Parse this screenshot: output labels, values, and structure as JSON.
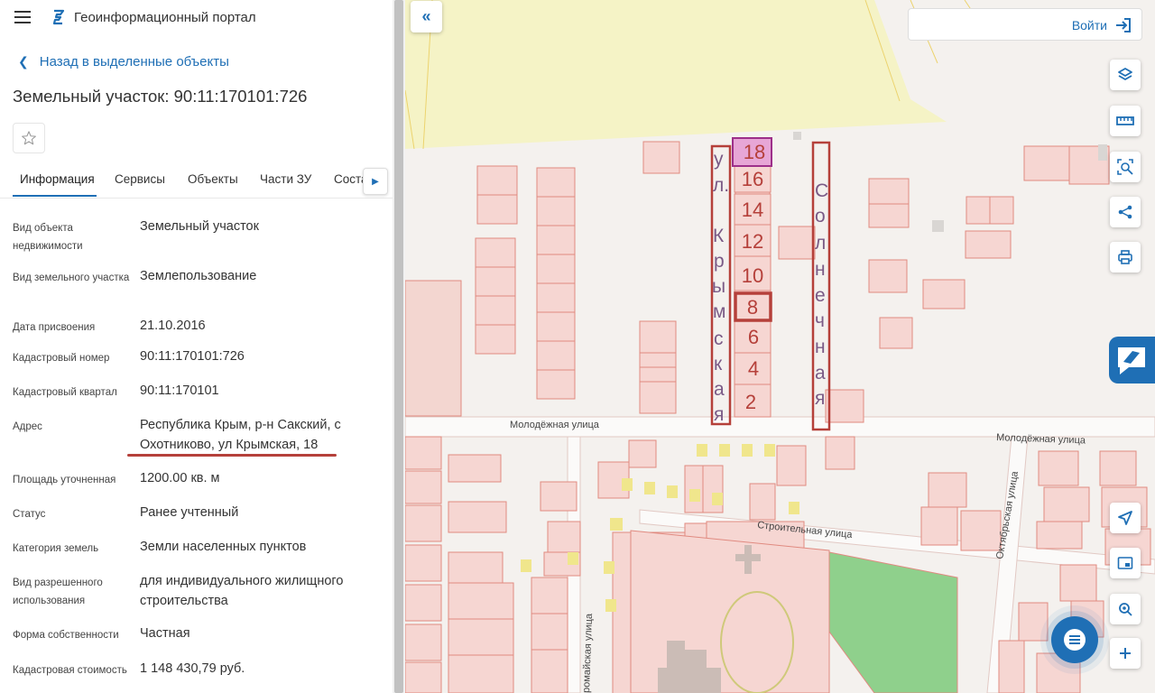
{
  "header": {
    "portal_title": "Геоинформационный портал"
  },
  "nav": {
    "back_label": "Назад в выделенные объекты"
  },
  "page": {
    "title": "Земельный участок: 90:11:170101:726"
  },
  "tabs": [
    {
      "label": "Информация",
      "active": true
    },
    {
      "label": "Сервисы",
      "active": false
    },
    {
      "label": "Объекты",
      "active": false
    },
    {
      "label": "Части ЗУ",
      "active": false
    },
    {
      "label": "Состав",
      "active": false
    }
  ],
  "properties": [
    {
      "label": "Вид объекта недвижимости",
      "value": "Земельный участок"
    },
    {
      "label": "Вид земельного участка",
      "value": "Землепользование"
    },
    {
      "label": "Дата присвоения",
      "value": "21.10.2016"
    },
    {
      "label": "Кадастровый номер",
      "value": "90:11:170101:726"
    },
    {
      "label": "Кадастровый квартал",
      "value": "90:11:170101"
    },
    {
      "label": "Адрес",
      "value": "Республика Крым, р-н Сакский, с Охотниково, ул Крымская, 18"
    },
    {
      "label": "Площадь уточненная",
      "value": "1200.00 кв. м"
    },
    {
      "label": "Статус",
      "value": "Ранее учтенный"
    },
    {
      "label": "Категория земель",
      "value": "Земли населенных пунктов"
    },
    {
      "label": "Вид разрешенного использования",
      "value": "для индивидуального жилищного строительства"
    },
    {
      "label": "Форма собственности",
      "value": "Частная"
    },
    {
      "label": "Кадастровая стоимость",
      "value": "1 148 430,79 руб."
    }
  ],
  "map": {
    "login_label": "Войти",
    "streets": {
      "molodezhnaya_1": "Молодёжная улица",
      "molodezhnaya_2": "Молодёжная улица",
      "stroitelnaya": "Строительная улица",
      "oktyabrskaya": "Октябрьская улица",
      "pervomayskaya": "ромайская улица"
    },
    "annotations": {
      "krymskaya": [
        "у",
        "л.",
        "К",
        "р",
        "ы",
        "м",
        "с",
        "к",
        "а",
        "я"
      ],
      "solnechnaya": [
        "С",
        "о",
        "л",
        "н",
        "е",
        "ч",
        "н",
        "а",
        "я"
      ],
      "house_numbers": [
        "18",
        "16",
        "14",
        "12",
        "10",
        "8",
        "6",
        "4",
        "2"
      ],
      "highlighted_number": "18",
      "boxed_number": "8"
    },
    "colors": {
      "accent": "#1f6fb5",
      "annotation": "#b5403a",
      "parcel_fill": "#f6d6d2",
      "parcel_stroke": "#e08a80",
      "selected_fill": "#e7a6d6",
      "selected_stroke": "#9d2f8a",
      "farmland": "#f5f3c6",
      "green_area": "#8fd08c"
    }
  }
}
